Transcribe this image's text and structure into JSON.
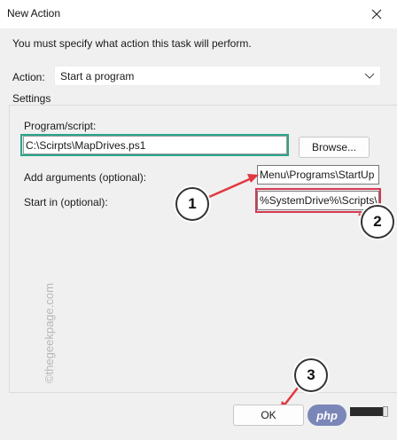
{
  "window": {
    "title": "New Action",
    "close_glyph": "✕"
  },
  "instruction": "You must specify what action this task will perform.",
  "action": {
    "label": "Action:",
    "value": "Start a program"
  },
  "settings": {
    "label": "Settings",
    "program": {
      "label": "Program/script:",
      "value": "C:\\Scirpts\\MapDrives.ps1",
      "browse_label": "Browse..."
    },
    "arguments": {
      "label": "Add arguments (optional):",
      "value": "Menu\\Programs\\StartUp"
    },
    "start_in": {
      "label": "Start in (optional):",
      "value": "%SystemDrive%\\Scripts\\"
    }
  },
  "buttons": {
    "ok_label": "OK"
  },
  "callouts": [
    "1",
    "2",
    "3"
  ],
  "watermark": "©thegeekpage.com",
  "badge": "php",
  "colors": {
    "green_highlight": "#2aa68a",
    "red_highlight": "#d43a52",
    "arrow_red": "#e2383f"
  },
  "icons": {
    "close": "close-icon",
    "dropdown": "chevron-down-icon"
  }
}
